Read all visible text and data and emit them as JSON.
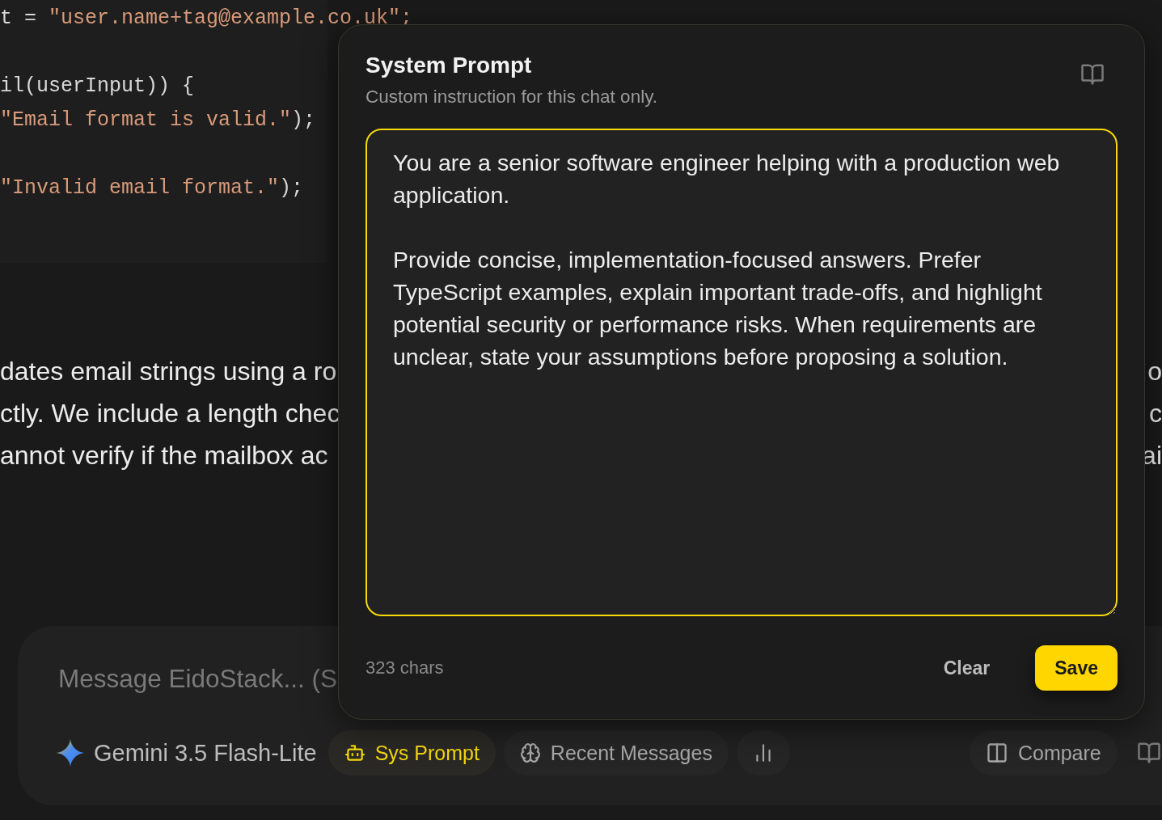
{
  "code_groups": [
    [
      {
        "segments": [
          {
            "kind": "plain",
            "text": "t = "
          },
          {
            "kind": "string",
            "text": "\"user.name+tag@example.co.uk\";"
          }
        ]
      }
    ],
    [
      {
        "segments": [
          {
            "kind": "plain",
            "text": "il(userInput)) {"
          }
        ]
      },
      {
        "segments": [
          {
            "kind": "string",
            "text": "\"Email format is valid.\""
          },
          {
            "kind": "plain",
            "text": ");"
          }
        ]
      }
    ],
    [
      {
        "segments": [
          {
            "kind": "string",
            "text": "\"Invalid email format.\""
          },
          {
            "kind": "plain",
            "text": ");"
          }
        ]
      }
    ]
  ],
  "paragraph_lines": [
    {
      "left": "dates email strings using a ro",
      "right": "o"
    },
    {
      "left": "ctly. We include a length chec",
      "right": "c"
    },
    {
      "left": "annot verify if the mailbox ac",
      "right": "ai"
    }
  ],
  "composer": {
    "placeholder": "Message EidoStack... (S",
    "model": "Gemini 3.5 Flash-Lite",
    "tools": [
      {
        "kind": "pill",
        "label": "Sys Prompt",
        "selected": true
      },
      {
        "kind": "pill",
        "label": "Recent Messages",
        "selected": false
      },
      {
        "kind": "icon",
        "selected": false
      }
    ],
    "compare": {
      "label": "Compare"
    }
  },
  "popover": {
    "title": "System Prompt",
    "subtitle": "Custom instruction for this chat only.",
    "prompt": "You are a senior software engineer helping with a production web application.\n\nProvide concise, implementation-focused answers. Prefer TypeScript examples, explain important trade-offs, and highlight potential security or performance risks. When requirements are unclear, state your assumptions before proposing a solution.",
    "count": "323 chars",
    "buttons": [
      {
        "kind": "secondary",
        "label": "Clear"
      },
      {
        "kind": "primary",
        "label": "Save"
      }
    ]
  }
}
